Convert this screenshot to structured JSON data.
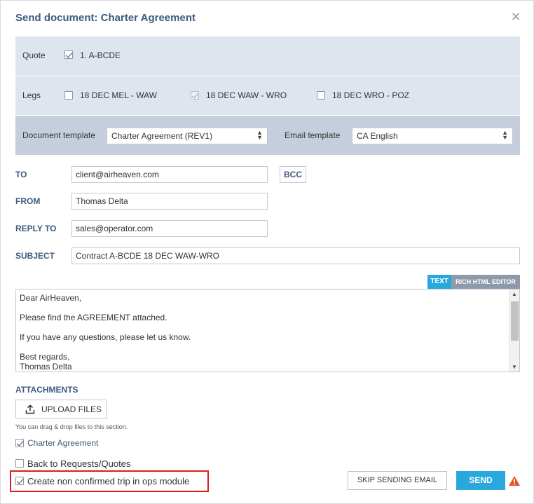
{
  "dialog": {
    "title": "Send document: Charter Agreement",
    "close_icon": "close-icon"
  },
  "quote": {
    "label": "Quote",
    "items": [
      {
        "label": "1. A-BCDE",
        "checked": true
      }
    ]
  },
  "legs": {
    "label": "Legs",
    "items": [
      {
        "label": "18 DEC MEL - WAW",
        "checked": false,
        "disabled": false
      },
      {
        "label": "18 DEC WAW - WRO",
        "checked": true,
        "disabled": true
      },
      {
        "label": "18 DEC WRO - POZ",
        "checked": false,
        "disabled": false
      }
    ]
  },
  "templates": {
    "document_label": "Document template",
    "document_value": "Charter Agreement (REV1)",
    "email_label": "Email template",
    "email_value": "CA English"
  },
  "fields": {
    "to_label": "TO",
    "to_value": "client@airheaven.com",
    "bcc_label": "BCC",
    "from_label": "FROM",
    "from_value": "Thomas Delta",
    "reply_label": "REPLY TO",
    "reply_value": "sales@operator.com",
    "subject_label": "SUBJECT",
    "subject_value": "Contract A-BCDE 18 DEC WAW-WRO"
  },
  "editor": {
    "tab_text": "TEXT",
    "tab_rich": "RICH HTML EDITOR",
    "lines": [
      "Dear AirHeaven,",
      "Please find the AGREEMENT attached.",
      "If you have any questions, please let us know.",
      "Best regards,",
      "Thomas Delta"
    ]
  },
  "attachments": {
    "label": "ATTACHMENTS",
    "upload_label": "UPLOAD FILES",
    "hint": "You can drag & drop files to this section.",
    "files": [
      {
        "label": "Charter Agreement",
        "checked": true
      }
    ]
  },
  "options": {
    "back_label": "Back to Requests/Quotes",
    "back_checked": false,
    "create_trip_label": "Create non confirmed trip in ops module",
    "create_trip_checked": true
  },
  "actions": {
    "skip_label": "SKIP SENDING EMAIL",
    "send_label": "SEND",
    "warning_icon": "warning-icon"
  },
  "colors": {
    "accent": "#29a8dd",
    "label_blue": "#3d5a80",
    "band_light": "#dfe5ef",
    "band_dark": "#c4cedc",
    "highlight": "#e01b1b",
    "warning": "#e8542a"
  }
}
